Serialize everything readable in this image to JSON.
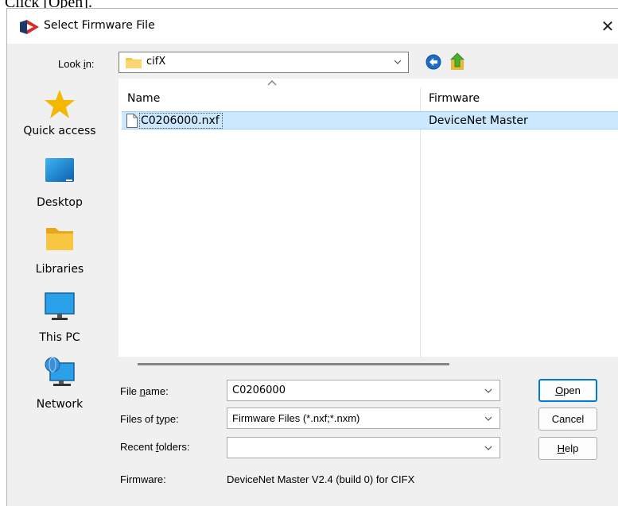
{
  "instruction": "Click [Open].",
  "dialog": {
    "title": "Select Firmware File",
    "close_glyph": "✕"
  },
  "lookin": {
    "label_pre": "Look ",
    "label_key": "i",
    "label_post": "n:",
    "value": "cifX"
  },
  "places": [
    {
      "label": "Quick access",
      "icon": "star-icon"
    },
    {
      "label": "Desktop",
      "icon": "desktop-icon"
    },
    {
      "label": "Libraries",
      "icon": "libraries-folder-icon"
    },
    {
      "label": "This PC",
      "icon": "monitor-icon"
    },
    {
      "label": "Network",
      "icon": "network-icon"
    }
  ],
  "filelist": {
    "columns": [
      "Name",
      "Firmware"
    ],
    "rows": [
      {
        "name": "C0206000.nxf",
        "firmware": "DeviceNet Master"
      }
    ]
  },
  "form": {
    "filename": {
      "label_pre": "File ",
      "label_key": "n",
      "label_post": "ame:",
      "value": "C0206000"
    },
    "filetype": {
      "label_pre": "Files of ",
      "label_key": "t",
      "label_post": "ype:",
      "value": "Firmware Files (*.nxf;*.nxm)"
    },
    "recent": {
      "label_pre": "Recent ",
      "label_key": "f",
      "label_post": "olders:",
      "value": ""
    },
    "firmware": {
      "label": "Firmware:",
      "value": "DeviceNet Master V2.4 (build 0) for CIFX"
    }
  },
  "buttons": {
    "open": {
      "key": "O",
      "rest": "pen"
    },
    "cancel": "Cancel",
    "help": {
      "key": "H",
      "rest": "elp"
    }
  },
  "colors": {
    "selection": "#cce8ff",
    "accent": "#0078d7",
    "folder": "#f8c640"
  }
}
